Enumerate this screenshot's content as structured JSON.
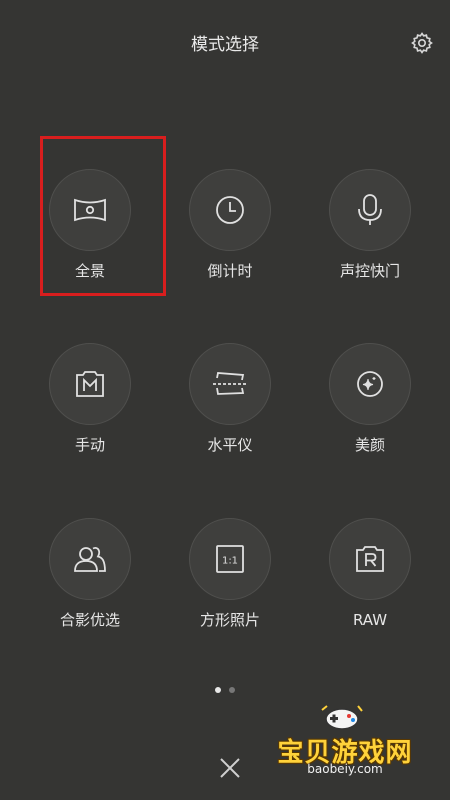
{
  "header": {
    "title": "模式选择",
    "settings_icon": "gear-icon"
  },
  "modes": [
    {
      "label": "全景",
      "icon": "panorama-icon"
    },
    {
      "label": "倒计时",
      "icon": "clock-icon"
    },
    {
      "label": "声控快门",
      "icon": "microphone-icon"
    },
    {
      "label": "手动",
      "icon": "manual-m-icon"
    },
    {
      "label": "水平仪",
      "icon": "level-icon"
    },
    {
      "label": "美颜",
      "icon": "beauty-sparkle-icon"
    },
    {
      "label": "合影优选",
      "icon": "group-photo-icon"
    },
    {
      "label": "方形照片",
      "icon": "square-1-1-icon"
    },
    {
      "label": "RAW",
      "icon": "raw-r-icon"
    }
  ],
  "pagination": {
    "total": 2,
    "active": 1
  },
  "highlight": {
    "color": "#d81e1e",
    "target": "全景"
  },
  "close_icon": "close-icon",
  "watermark": {
    "title": "宝贝游戏网",
    "url": "baobeiy.com"
  }
}
